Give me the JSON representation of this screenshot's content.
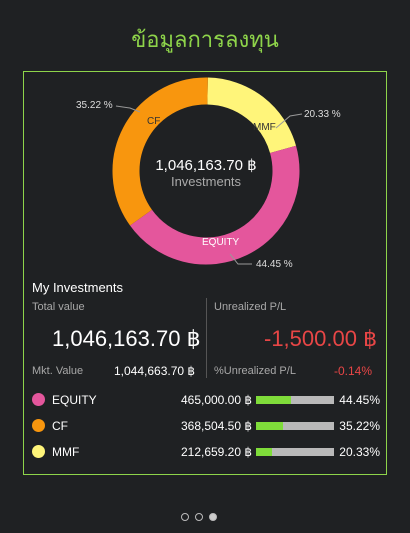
{
  "page_title": "ข้อมูลการลงทุน",
  "colors": {
    "equity": "#e4569c",
    "cf": "#f8960e",
    "mmf": "#fff57a",
    "accent": "#8ed44a",
    "negative": "#e84646"
  },
  "donut": {
    "center_value": "1,046,163.70 ฿",
    "center_label": "Investments",
    "slices": [
      {
        "name": "EQUITY",
        "percent": 44.45,
        "label_pct": "44.45 %"
      },
      {
        "name": "CF",
        "percent": 35.22,
        "label_pct": "35.22 %"
      },
      {
        "name": "MMF",
        "percent": 20.33,
        "label_pct": "20.33 %"
      }
    ]
  },
  "summary": {
    "section_title": "My Investments",
    "total_value_label": "Total value",
    "total_value": "1,046,163.70 ฿",
    "mkt_value_label": "Mkt. Value",
    "mkt_value": "1,044,663.70 ฿",
    "unrealized_label": "Unrealized P/L",
    "unrealized_value": "-1,500.00 ฿",
    "pct_unrealized_label": "%Unrealized P/L",
    "pct_unrealized_value": "-0.14%"
  },
  "funds": [
    {
      "name": "EQUITY",
      "amount": "465,000.00 ฿",
      "percent_text": "44.45%",
      "fill": 0.4445,
      "color": "#e4569c"
    },
    {
      "name": "CF",
      "amount": "368,504.50 ฿",
      "percent_text": "35.22%",
      "fill": 0.3522,
      "color": "#f8960e"
    },
    {
      "name": "MMF",
      "amount": "212,659.20 ฿",
      "percent_text": "20.33%",
      "fill": 0.2033,
      "color": "#fff57a"
    }
  ],
  "pager": {
    "count": 3,
    "active": 2
  }
}
